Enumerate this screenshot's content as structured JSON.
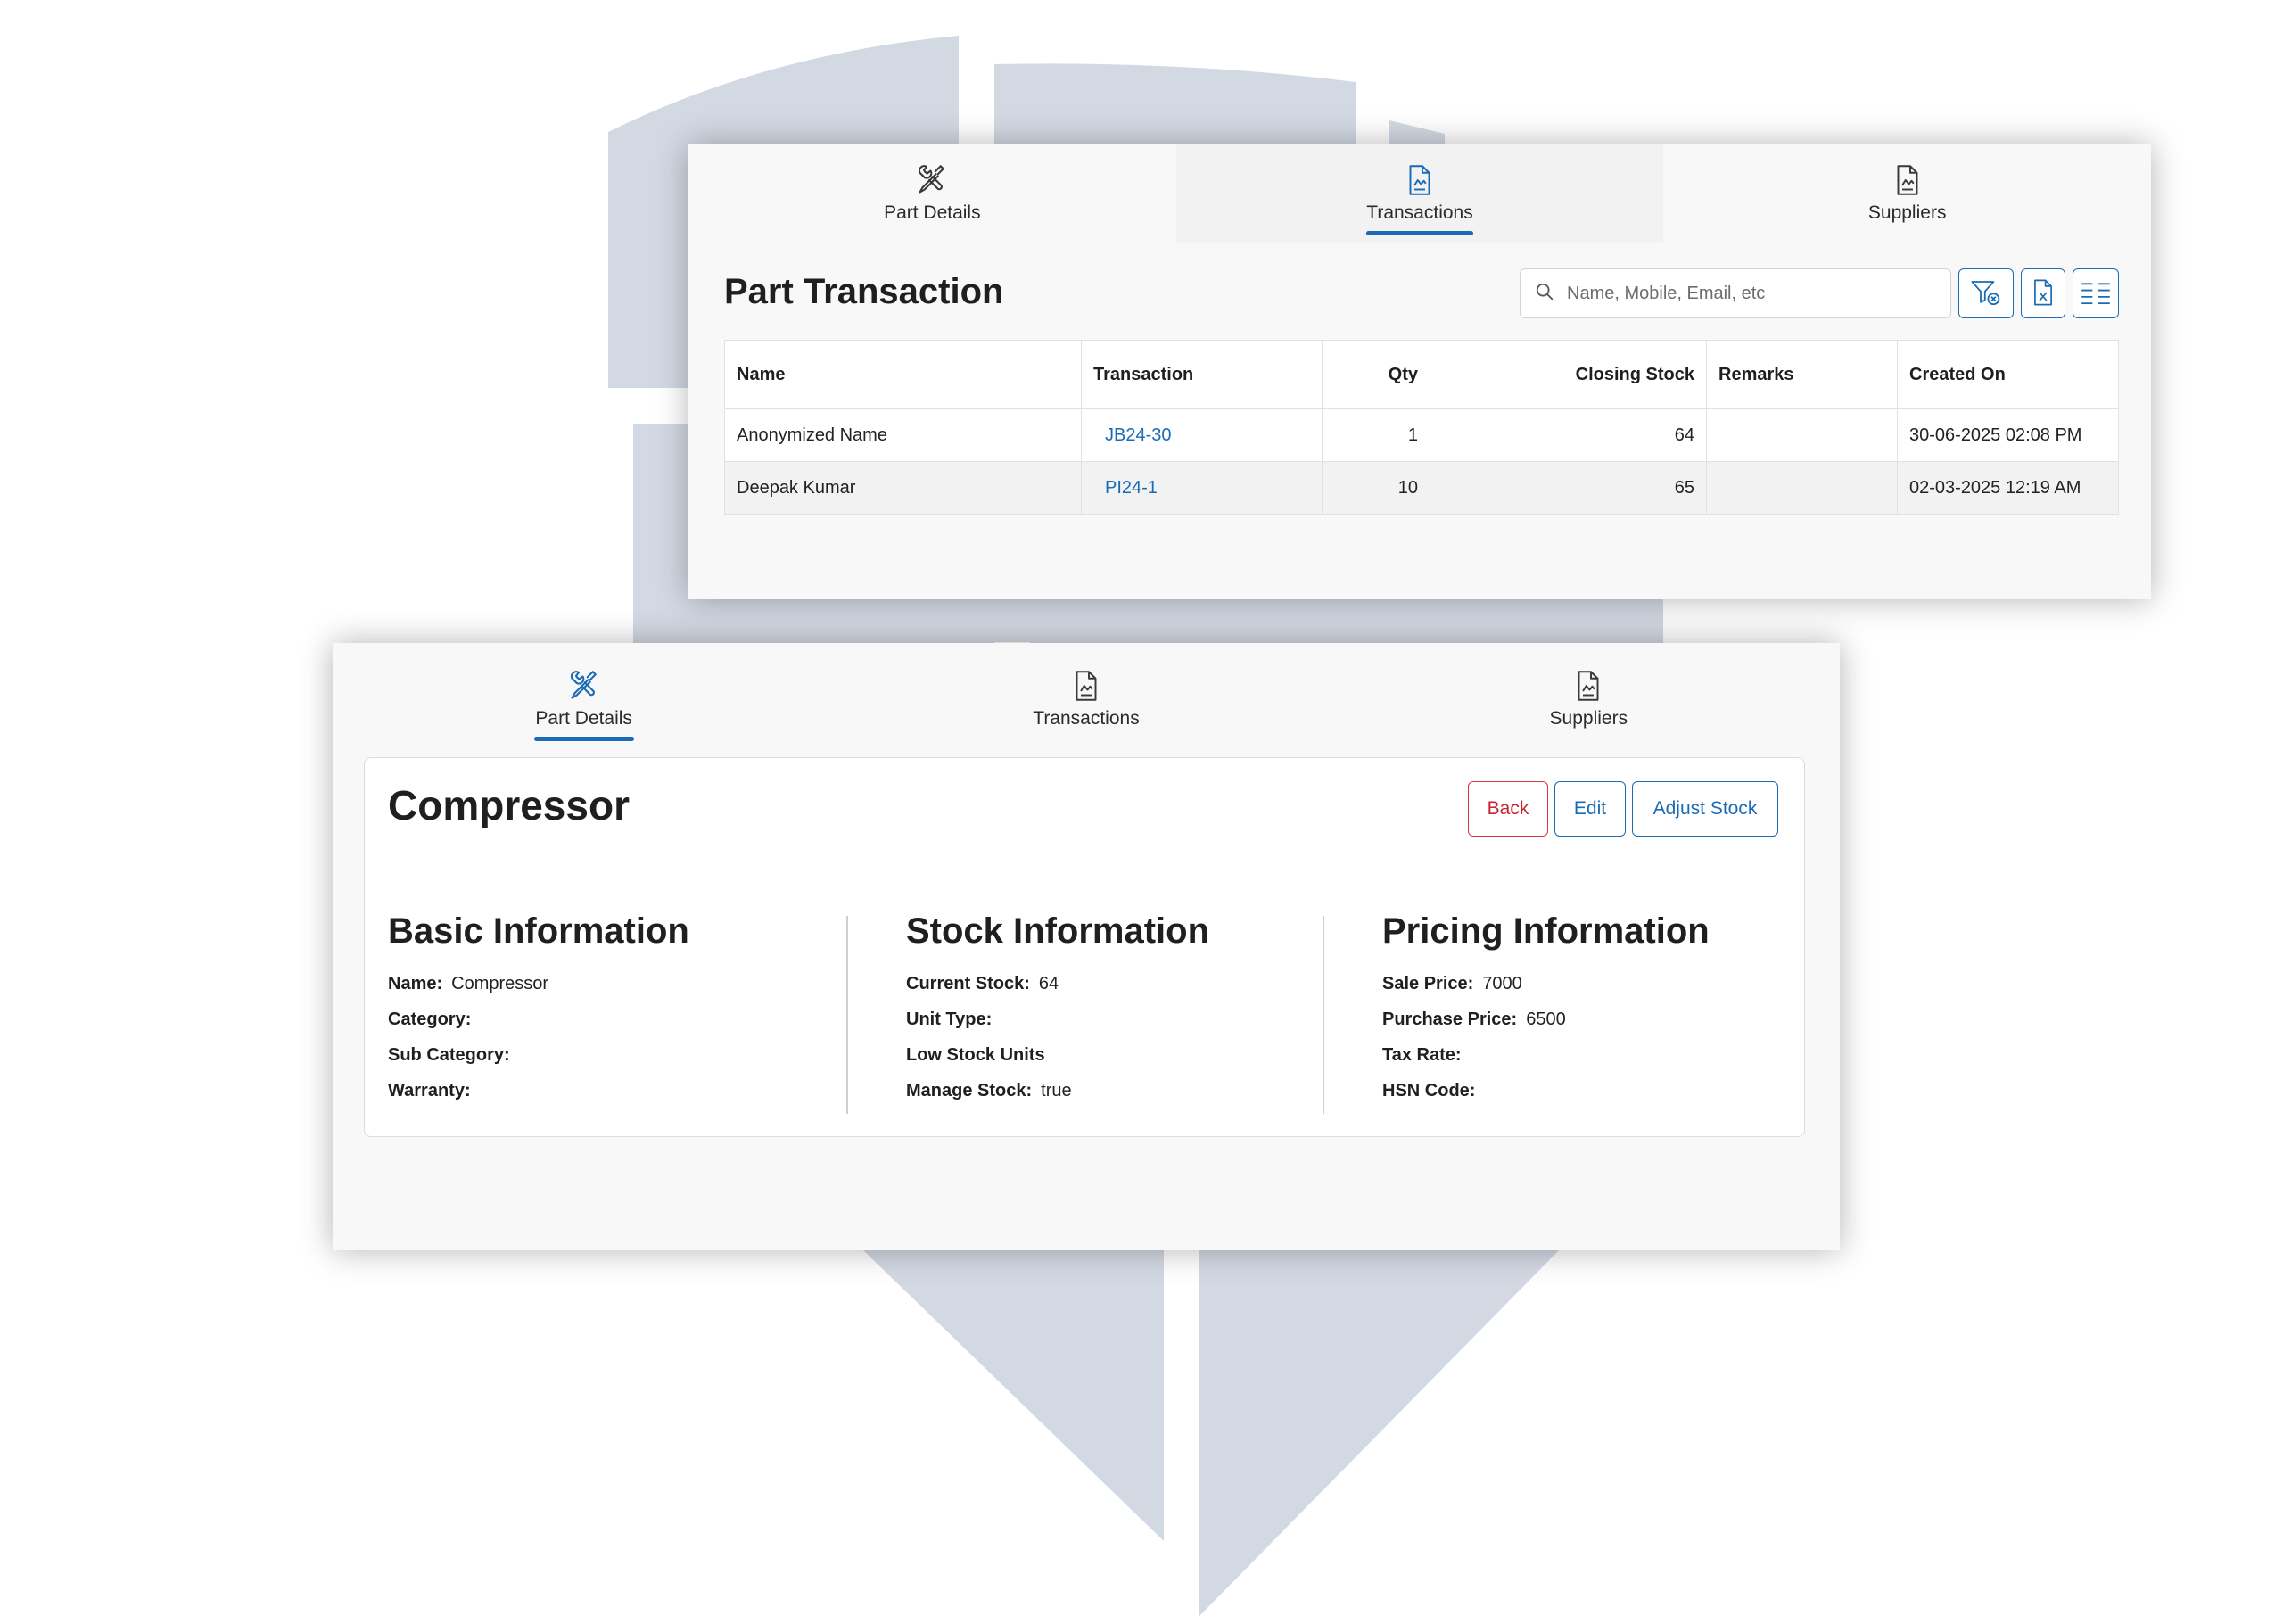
{
  "colors": {
    "accent": "#1a6bb5",
    "danger": "#dc3545",
    "shield": "#d3d9e3"
  },
  "tabs": [
    {
      "label": "Part Details",
      "icon": "tools-icon"
    },
    {
      "label": "Transactions",
      "icon": "document-chart-icon"
    },
    {
      "label": "Suppliers",
      "icon": "document-chart-icon"
    }
  ],
  "transactions_card": {
    "active_tab": "Transactions",
    "title": "Part Transaction",
    "search_placeholder": "Name, Mobile, Email, etc",
    "toolbar_icons": [
      "filter-clear-icon",
      "excel-export-icon",
      "column-toggle-icon"
    ],
    "columns": [
      "Name",
      "Transaction",
      "Qty",
      "Closing Stock",
      "Remarks",
      "Created On"
    ],
    "rows": [
      {
        "name": "Anonymized Name",
        "transaction": "JB24-30",
        "qty": "1",
        "closing_stock": "64",
        "remarks": "",
        "created_on": "30-06-2025 02:08 PM"
      },
      {
        "name": "Deepak Kumar",
        "transaction": "PI24-1",
        "qty": "10",
        "closing_stock": "65",
        "remarks": "",
        "created_on": "02-03-2025 12:19 AM"
      }
    ]
  },
  "details_card": {
    "active_tab": "Part Details",
    "title": "Compressor",
    "buttons": {
      "back": "Back",
      "edit": "Edit",
      "adjust": "Adjust Stock"
    },
    "basic": {
      "title": "Basic Information",
      "fields": [
        {
          "label": "Name:",
          "value": "Compressor"
        },
        {
          "label": "Category:",
          "value": ""
        },
        {
          "label": "Sub Category:",
          "value": ""
        },
        {
          "label": "Warranty:",
          "value": ""
        }
      ]
    },
    "stock": {
      "title": "Stock Information",
      "fields": [
        {
          "label": "Current Stock:",
          "value": "64"
        },
        {
          "label": "Unit Type:",
          "value": ""
        },
        {
          "label": "Low Stock Units",
          "value": ""
        },
        {
          "label": "Manage Stock:",
          "value": "true"
        }
      ]
    },
    "pricing": {
      "title": "Pricing Information",
      "fields": [
        {
          "label": "Sale Price:",
          "value": "7000"
        },
        {
          "label": "Purchase Price:",
          "value": "6500"
        },
        {
          "label": "Tax Rate:",
          "value": ""
        },
        {
          "label": "HSN Code:",
          "value": ""
        }
      ]
    }
  }
}
